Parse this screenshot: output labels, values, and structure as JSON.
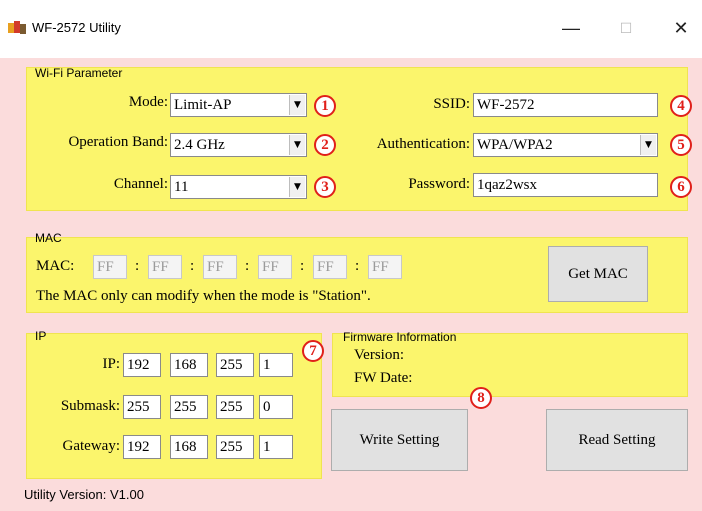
{
  "window": {
    "title": "WF-2572 Utility",
    "minimize": "—",
    "maximize": "☐",
    "close": "✕"
  },
  "wifi": {
    "group_label": "Wi-Fi Parameter",
    "mode_label": "Mode:",
    "mode_value": "Limit-AP",
    "band_label": "Operation Band:",
    "band_value": "2.4 GHz",
    "channel_label": "Channel:",
    "channel_value": "11",
    "ssid_label": "SSID:",
    "ssid_value": "WF-2572",
    "auth_label": "Authentication:",
    "auth_value": "WPA/WPA2",
    "password_label": "Password:",
    "password_value": "1qaz2wsx"
  },
  "mac": {
    "group_label": "MAC",
    "mac_label": "MAC:",
    "octets": [
      "FF",
      "FF",
      "FF",
      "FF",
      "FF",
      "FF"
    ],
    "separator": ":",
    "note": "The MAC only can modify when the mode is \"Station\".",
    "get_button": "Get MAC"
  },
  "ip": {
    "group_label": "IP",
    "ip_label": "IP:",
    "ip": [
      "192",
      "168",
      "255",
      "1"
    ],
    "submask_label": "Submask:",
    "submask": [
      "255",
      "255",
      "255",
      "0"
    ],
    "gateway_label": "Gateway:",
    "gateway": [
      "192",
      "168",
      "255",
      "1"
    ]
  },
  "firmware": {
    "group_label": "Firmware Information",
    "version_label": "Version:",
    "version_value": "",
    "date_label": "FW Date:",
    "date_value": ""
  },
  "buttons": {
    "write": "Write Setting",
    "read": "Read Setting"
  },
  "badges": [
    "1",
    "2",
    "3",
    "4",
    "5",
    "6",
    "7",
    "8"
  ],
  "footer": {
    "utility_version": "Utility Version: V1.00"
  },
  "colors": {
    "client_bg": "#fbdcdc",
    "group_bg": "#fbf56c",
    "badge": "#e0201a"
  }
}
